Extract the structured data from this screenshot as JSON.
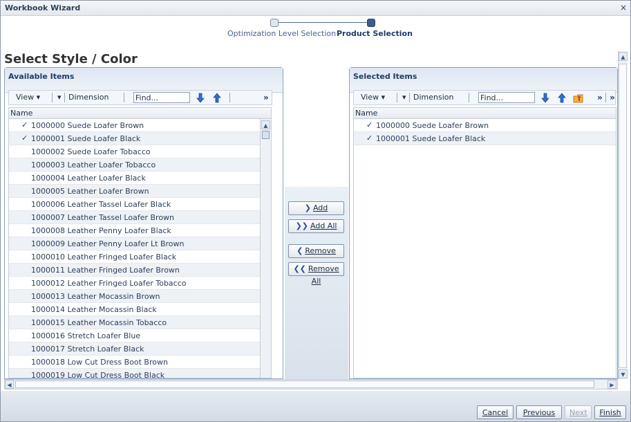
{
  "window": {
    "title": "Workbook Wizard",
    "close_icon": "×"
  },
  "train": {
    "steps": [
      {
        "label": "Optimization Level Selection",
        "state": "visited"
      },
      {
        "label": "Product Selection",
        "state": "current"
      }
    ]
  },
  "page_title": "Select Style / Color",
  "available": {
    "title": "Available Items",
    "toolbar": {
      "view_label": "View ▾",
      "dimension_label": "Dimension",
      "find_placeholder": "Find...",
      "more": "»"
    },
    "column_header": "Name",
    "rows": [
      {
        "label": "1000000 Suede Loafer Brown",
        "checked": true
      },
      {
        "label": "1000001 Suede Loafer Black",
        "checked": true
      },
      {
        "label": "1000002 Suede Loafer Tobacco",
        "checked": false
      },
      {
        "label": "1000003 Leather Loafer Tobacco",
        "checked": false
      },
      {
        "label": "1000004 Leather Loafer Black",
        "checked": false
      },
      {
        "label": "1000005 Leather Loafer Brown",
        "checked": false
      },
      {
        "label": "1000006 Leather Tassel Loafer Black",
        "checked": false
      },
      {
        "label": "1000007 Leather Tassel Loafer Brown",
        "checked": false
      },
      {
        "label": "1000008 Leather Penny Loafer Black",
        "checked": false
      },
      {
        "label": "1000009 Leather Penny Loafer Lt Brown",
        "checked": false
      },
      {
        "label": "1000010 Leather Fringed Loafer Black",
        "checked": false
      },
      {
        "label": "1000011 Leather Fringed Loafer Brown",
        "checked": false
      },
      {
        "label": "1000012 Leather Fringed Loafer Tobacco",
        "checked": false
      },
      {
        "label": "1000013 Leather Mocassin Brown",
        "checked": false
      },
      {
        "label": "1000014 Leather Mocassin Black",
        "checked": false
      },
      {
        "label": "1000015 Leather Mocassin Tobacco",
        "checked": false
      },
      {
        "label": "1000016 Stretch Loafer Blue",
        "checked": false
      },
      {
        "label": "1000017 Stretch Loafer Black",
        "checked": false
      },
      {
        "label": "1000018 Low Cut Dress Boot Brown",
        "checked": false
      },
      {
        "label": "1000019 Low Cut Dress Boot Black",
        "checked": false
      }
    ]
  },
  "selected": {
    "title": "Selected Items",
    "toolbar": {
      "view_label": "View ▾",
      "dimension_label": "Dimension",
      "find_placeholder": "Find...",
      "more": "»"
    },
    "column_header": "Name",
    "rows": [
      {
        "label": "1000000 Suede Loafer Brown",
        "checked": true
      },
      {
        "label": "1000001 Suede Loafer Black",
        "checked": true
      }
    ]
  },
  "shuttle": {
    "add": "Add",
    "add_all": "Add All",
    "remove": "Remove",
    "remove_all": "Remove All"
  },
  "footer": {
    "cancel": "Cancel",
    "previous": "Previous",
    "next": "Next",
    "finish": "Finish"
  },
  "colors": {
    "accent": "#1f3b66",
    "panel_border": "#8aa3c4",
    "check": "#23406a"
  }
}
